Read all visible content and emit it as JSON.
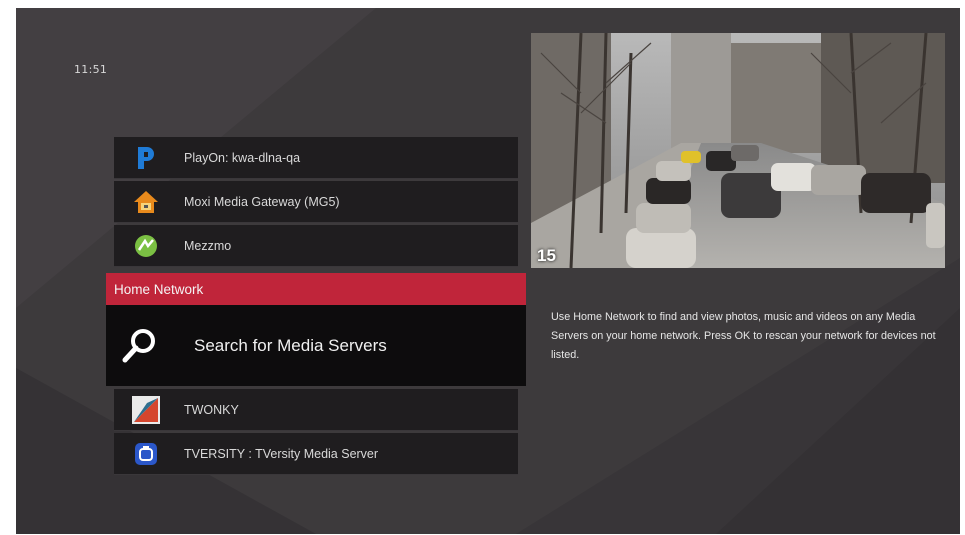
{
  "clock": "11:51",
  "menu": {
    "items_above": [
      {
        "label": "PlayOn: kwa-dlna-qa",
        "icon": "playon-icon"
      },
      {
        "label": "Moxi Media Gateway (MG5)",
        "icon": "moxi-house-icon"
      },
      {
        "label": "Mezzmo",
        "icon": "mezzmo-icon"
      }
    ],
    "section_header": "Home Network",
    "selected": {
      "label": "Search for Media Servers",
      "icon": "search-icon"
    },
    "items_below": [
      {
        "label": "TWONKY",
        "icon": "twonky-icon"
      },
      {
        "label": "TVERSITY : TVersity Media Server",
        "icon": "tversity-icon"
      }
    ]
  },
  "preview": {
    "channel_number": "15",
    "image": "city-street-parked-cars"
  },
  "description": "Use Home Network to find and view photos, music and videos on any Media Servers on your home network. Press OK to rescan your network for devices not listed.",
  "colors": {
    "background": "#3d3a3c",
    "accent": "#c0253a",
    "row_bg": "#1f1d1f",
    "selected_bg": "#0d0c0d"
  }
}
